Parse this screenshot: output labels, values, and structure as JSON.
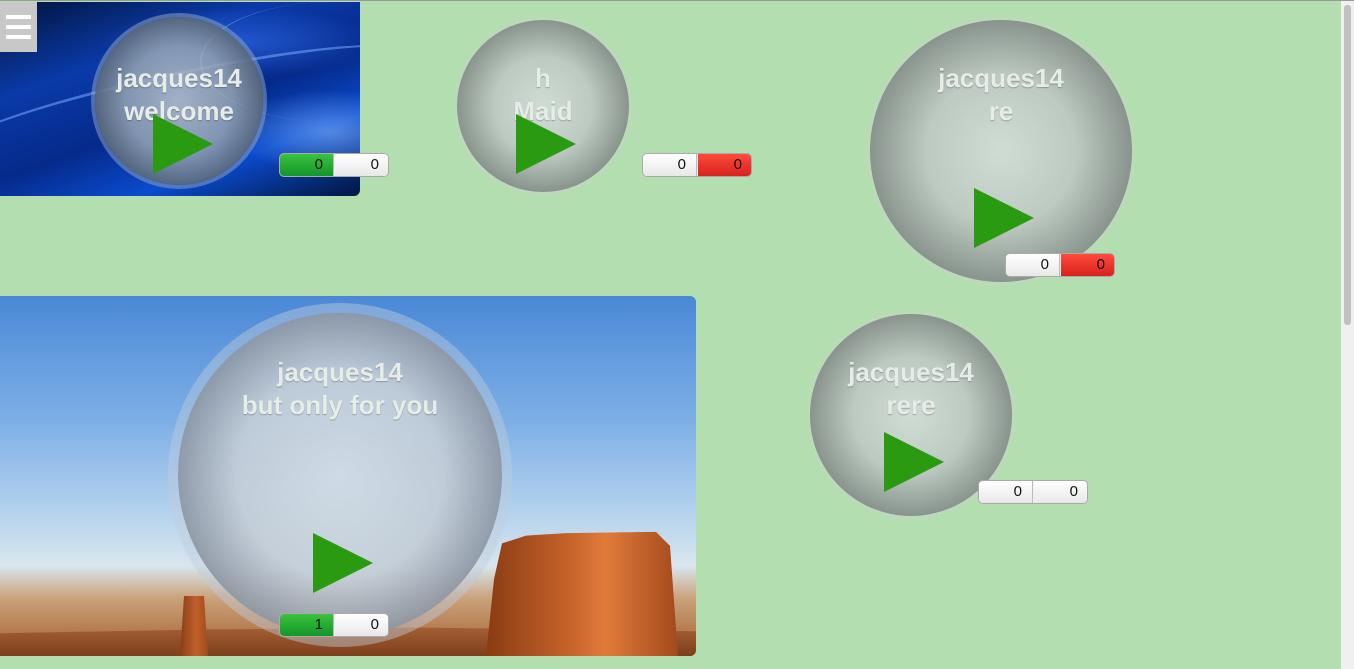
{
  "menu": {
    "icon": "hamburger-menu-icon"
  },
  "colors": {
    "background": "#b3dfb0",
    "play": "#2a9a10",
    "like": "#1fa52e",
    "dislike": "#e3271f"
  },
  "posts": [
    {
      "user": "jacques14",
      "message": "welcome",
      "likes": "0",
      "dislikes": "0"
    },
    {
      "user": "h",
      "message": "Maid",
      "likes": "0",
      "dislikes": "0"
    },
    {
      "user": "jacques14",
      "message": "re",
      "likes": "0",
      "dislikes": "0"
    },
    {
      "user": "jacques14",
      "message": "but only for you",
      "likes": "1",
      "dislikes": "0"
    },
    {
      "user": "jacques14",
      "message": "rere",
      "likes": "0",
      "dislikes": "0"
    }
  ]
}
